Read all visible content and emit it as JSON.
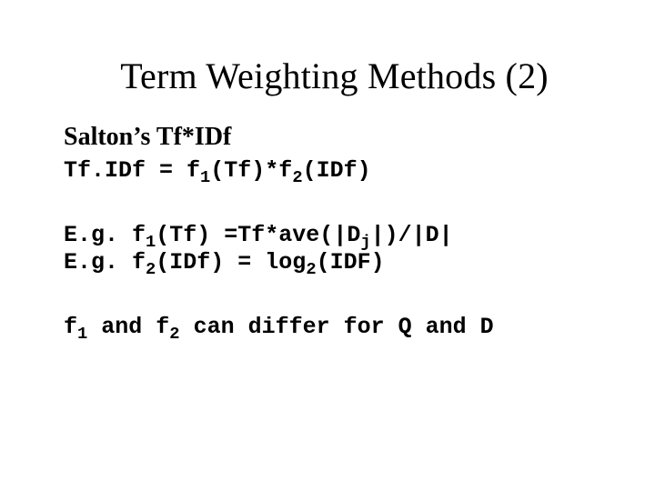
{
  "title": "Term Weighting Methods (2)",
  "subhead": "Salton’s Tf*IDf",
  "formula_main": {
    "lead": "Tf.IDf = f",
    "sub1": "1",
    "mid1": "(Tf)*f",
    "sub2": "2",
    "tail": "(IDf)"
  },
  "example1": {
    "lead": "E.g. f",
    "sub": "1",
    "mid": "(Tf) =Tf*ave(|D",
    "subj": "j",
    "tail": "|)/|D|"
  },
  "example2": {
    "lead": "E.g. f",
    "sub": "2",
    "mid": "(IDf) = log",
    "sublog": "2",
    "tail": "(IDF)"
  },
  "closing": {
    "p1": "f",
    "s1": "1",
    "p2": " and f",
    "s2": "2",
    "p3": " can differ for Q and D"
  }
}
